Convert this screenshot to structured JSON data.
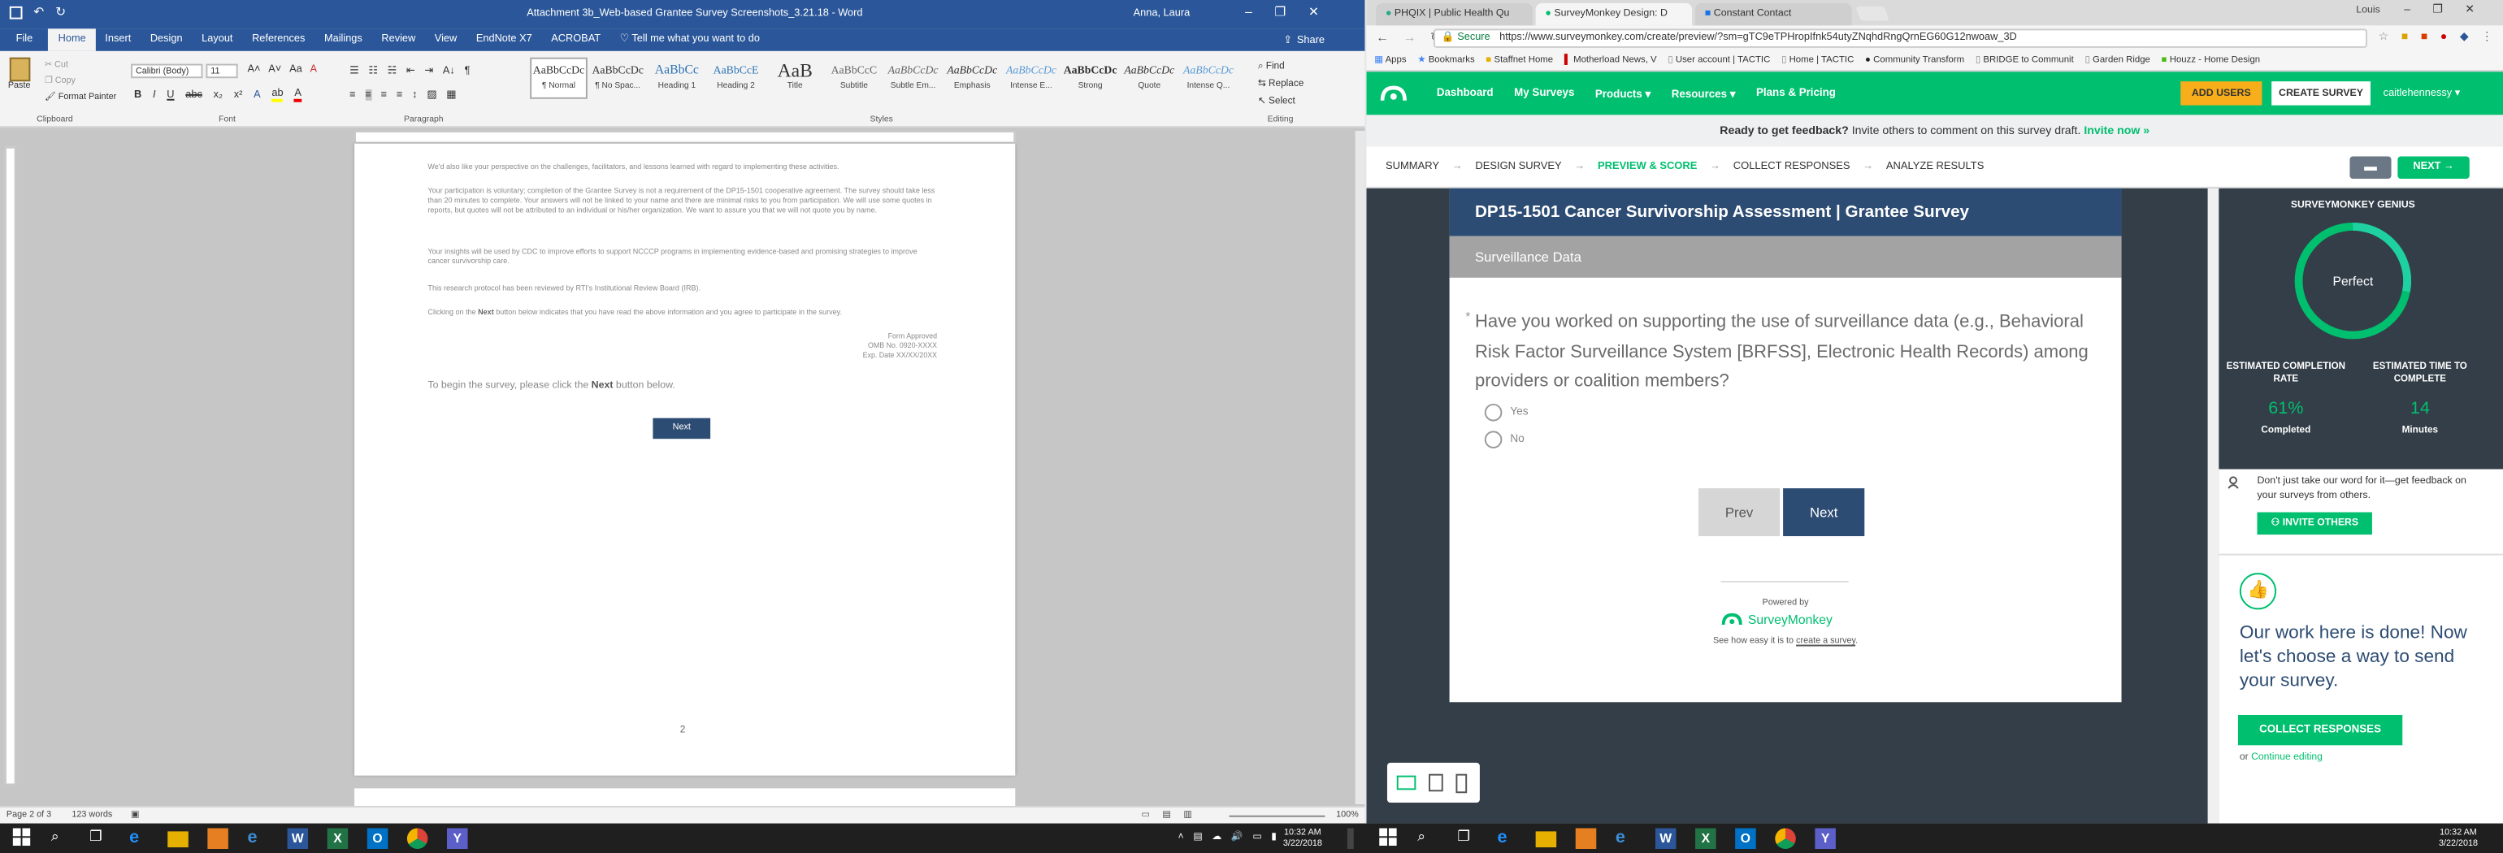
{
  "word": {
    "window_title": "Attachment 3b_Web-based Grantee Survey Screenshots_3.21.18 - Word",
    "user": "Anna, Laura",
    "share_label": "Share",
    "menu_tabs": [
      "File",
      "Home",
      "Insert",
      "Design",
      "Layout",
      "References",
      "Mailings",
      "Review",
      "View",
      "EndNote X7",
      "ACROBAT"
    ],
    "tell_me": "Tell me what you want to do",
    "clipboard": {
      "paste": "Paste",
      "cut": "Cut",
      "copy": "Copy",
      "format_painter": "Format Painter",
      "label": "Clipboard"
    },
    "font": {
      "name": "Calibri (Body)",
      "size": "11",
      "label": "Font"
    },
    "paragraph_label": "Paragraph",
    "styles_label": "Styles",
    "styles": [
      {
        "sample": "AaBbCcDc",
        "name": "¶ Normal"
      },
      {
        "sample": "AaBbCcDc",
        "name": "¶ No Spac..."
      },
      {
        "sample": "AaBbCc",
        "name": "Heading 1"
      },
      {
        "sample": "AaBbCcE",
        "name": "Heading 2"
      },
      {
        "sample": "AaB",
        "name": "Title"
      },
      {
        "sample": "AaBbCcC",
        "name": "Subtitle"
      },
      {
        "sample": "AaBbCcDc",
        "name": "Subtle Em..."
      },
      {
        "sample": "AaBbCcDc",
        "name": "Emphasis"
      },
      {
        "sample": "AaBbCcDc",
        "name": "Intense E..."
      },
      {
        "sample": "AaBbCcDc",
        "name": "Strong"
      },
      {
        "sample": "AaBbCcDc",
        "name": "Quote"
      },
      {
        "sample": "AaBbCcDc",
        "name": "Intense Q..."
      }
    ],
    "editing": {
      "find": "Find",
      "replace": "Replace",
      "select": "Select",
      "label": "Editing"
    },
    "doc": {
      "p1": "We'd also like your perspective on the challenges, facilitators, and lessons learned with regard to implementing these activities.",
      "p2": "Your participation is voluntary; completion of the Grantee Survey is not a requirement of the DP15-1501 cooperative agreement. The survey should take less than 20 minutes to complete. Your answers will not be linked to your name and there are minimal risks to you from participation. We will use some quotes in reports, but quotes will not be attributed to an individual or his/her organization. We want to assure you that we will not quote you by name.",
      "p3": "Your insights will be used by CDC to improve efforts to support NCCCP programs in implementing evidence-based and promising strategies to improve cancer survivorship care.",
      "p4": "This research protocol has been reviewed by RTI's Institutional Review Board (IRB).",
      "p5a": "Clicking on the ",
      "p5b": "Next",
      "p5c": " button below indicates that you have read the above information and you agree to participate in the survey.",
      "form1": "Form Approved",
      "form2": "OMB No. 0920-XXXX",
      "form3": "Exp. Date XX/XX/20XX",
      "begin_a": "To begin the survey, please click the ",
      "begin_b": "Next",
      "begin_c": " button below.",
      "next_button": "Next",
      "page_number": "2"
    },
    "status": {
      "page": "Page 2 of 3",
      "words": "123 words",
      "zoom": "100%"
    }
  },
  "chrome": {
    "tabs": [
      "PHQIX | Public Health Qu",
      "SurveyMonkey Design: D",
      "Constant Contact"
    ],
    "account": "Louis",
    "secure": "Secure",
    "url": "https://www.surveymonkey.com/create/preview/?sm=gTC9eTPHropIfnk54utyZNqhdRngQrnEG60G12nwoaw_3D",
    "bookmarks": [
      "Apps",
      "Bookmarks",
      "Staffnet Home",
      "Motherload News, V",
      "User account | TACTIC",
      "Home | TACTIC",
      "Community Transform",
      "BRIDGE to Communit",
      "Garden Ridge",
      "Houzz - Home Design"
    ]
  },
  "sm": {
    "nav": [
      "Dashboard",
      "My Surveys",
      "Products",
      "Resources",
      "Plans & Pricing"
    ],
    "add_users": "ADD USERS",
    "create_survey": "CREATE SURVEY",
    "username": "caitlehennessy",
    "feedback_bold": "Ready to get feedback?",
    "feedback_text": " Invite others to comment on this survey draft. ",
    "feedback_link": "Invite now »",
    "steps": [
      "SUMMARY",
      "DESIGN SURVEY",
      "PREVIEW & SCORE",
      "COLLECT RESPONSES",
      "ANALYZE RESULTS"
    ],
    "next_step": "NEXT",
    "survey_title": "DP15-1501 Cancer Survivorship Assessment | Grantee Survey",
    "page_title": "Surveillance Data",
    "question": "Have you worked on supporting the use of surveillance data (e.g., Behavioral Risk Factor Surveillance System [BRFSS], Electronic Health Records) among providers or coalition members?",
    "options": [
      "Yes",
      "No"
    ],
    "prev": "Prev",
    "next": "Next",
    "powered_by": "Powered by",
    "brand": "SurveyMonkey",
    "see_how": "See how easy it is to ",
    "create_link": "create a survey",
    "genius_title": "SURVEYMONKEY GENIUS",
    "genius_score": "Perfect",
    "completion_title": "ESTIMATED COMPLETION RATE",
    "completion_value": "61%",
    "completion_unit": "Completed",
    "time_title": "ESTIMATED TIME TO COMPLETE",
    "time_value": "14",
    "time_unit": "Minutes",
    "dont_take": "Don't just take our word for it—get feedback on your surveys from others.",
    "invite_others": "INVITE OTHERS",
    "done_text": "Our work here is done! Now let's choose a way to send your survey.",
    "collect_responses": "COLLECT RESPONSES",
    "or_text": "or ",
    "continue_editing": "Continue editing",
    "accent": "#00bf6f"
  },
  "taskbar": {
    "time": "10:32 AM",
    "date": "3/22/2018"
  }
}
